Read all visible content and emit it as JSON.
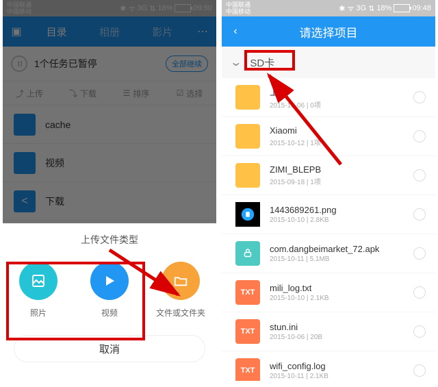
{
  "status": {
    "carrier1": "中国联通",
    "carrier2": "中国移动",
    "network": "3G",
    "wifi": "•",
    "battery": "18%",
    "time_left": "09:50",
    "time_right": "09:48"
  },
  "left": {
    "tabs": [
      "目录",
      "相册",
      "影片"
    ],
    "paused_task": "1个任务已暂停",
    "resume_all": "全部继续",
    "actions": {
      "upload": "上传",
      "download": "下载",
      "sort": "排序",
      "select": "选择"
    },
    "items": [
      {
        "label": "cache"
      },
      {
        "label": "视频"
      },
      {
        "label": "下载"
      }
    ],
    "sheet_title": "上传文件类型",
    "types": [
      {
        "label": "照片",
        "color": "#25c3d6"
      },
      {
        "label": "视频",
        "color": "#2196f3"
      },
      {
        "label": "文件或文件夹",
        "color": "#f8a33a"
      }
    ],
    "cancel": "取消"
  },
  "right": {
    "title": "请选择项目",
    "sd_label": "SD卡",
    "rows": [
      {
        "kind": "folder",
        "name": "上",
        "sub": "2015-10-06 | 0项"
      },
      {
        "kind": "folder",
        "name": "Xiaomi",
        "sub": "2015-10-12 | 1项"
      },
      {
        "kind": "folder",
        "name": "ZIMI_BLEPB",
        "sub": "2015-09-18 | 1项"
      },
      {
        "kind": "png",
        "name": "1443689261.png",
        "sub": "2015-10-10 | 2.8KB"
      },
      {
        "kind": "apk",
        "name": "com.dangbeimarket_72.apk",
        "sub": "2015-10-11 | 5.1MB"
      },
      {
        "kind": "txt",
        "name": "mili_log.txt",
        "sub": "2015-10-10 | 2.1KB"
      },
      {
        "kind": "txt",
        "name": "stun.ini",
        "sub": "2015-10-06 | 20B"
      },
      {
        "kind": "txt",
        "name": "wifi_config.log",
        "sub": "2015-10-11 | 2.1KB"
      }
    ]
  }
}
